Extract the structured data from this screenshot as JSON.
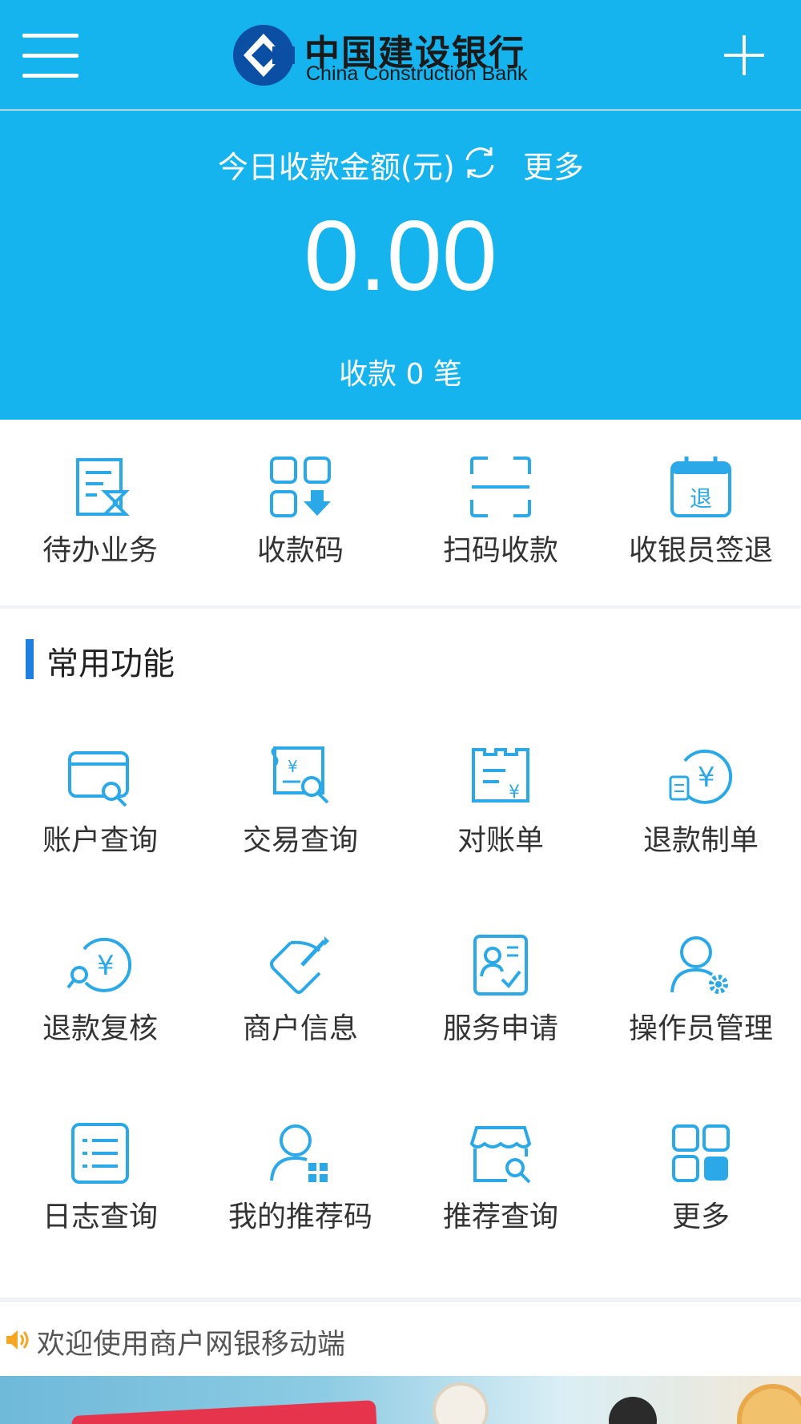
{
  "header": {
    "logo_cn": "中国建设银行",
    "logo_en": "China Construction Bank"
  },
  "summary": {
    "title": "今日收款金额(元)",
    "more": "更多",
    "amount": "0.00",
    "count": "收款 0 笔"
  },
  "quick_actions": [
    {
      "label": "待办业务",
      "icon": "todo-document-hourglass-icon"
    },
    {
      "label": "收款码",
      "icon": "payment-qr-code-icon"
    },
    {
      "label": "扫码收款",
      "icon": "scan-frame-icon"
    },
    {
      "label": "收银员签退",
      "icon": "calendar-signout-icon"
    }
  ],
  "section": {
    "title": "常用功能"
  },
  "functions": [
    {
      "label": "账户查询",
      "icon": "card-search-icon"
    },
    {
      "label": "交易查询",
      "icon": "receipt-search-icon"
    },
    {
      "label": "对账单",
      "icon": "statement-yuan-icon"
    },
    {
      "label": "退款制单",
      "icon": "refund-yuan-clipboard-icon"
    },
    {
      "label": "退款复核",
      "icon": "refund-review-icon"
    },
    {
      "label": "商户信息",
      "icon": "edit-merchant-icon"
    },
    {
      "label": "服务申请",
      "icon": "service-application-icon"
    },
    {
      "label": "操作员管理",
      "icon": "user-gear-icon"
    },
    {
      "label": "日志查询",
      "icon": "log-list-icon"
    },
    {
      "label": "我的推荐码",
      "icon": "user-qr-icon"
    },
    {
      "label": "推荐查询",
      "icon": "shop-search-icon"
    },
    {
      "label": "更多",
      "icon": "grid-more-icon"
    }
  ],
  "notice": {
    "text": "欢迎使用商户网银移动端"
  },
  "colors": {
    "primary": "#16b4ef",
    "icon": "#2aa8e8",
    "accent_bar": "#1e7fe0",
    "speaker": "#f5a623"
  }
}
